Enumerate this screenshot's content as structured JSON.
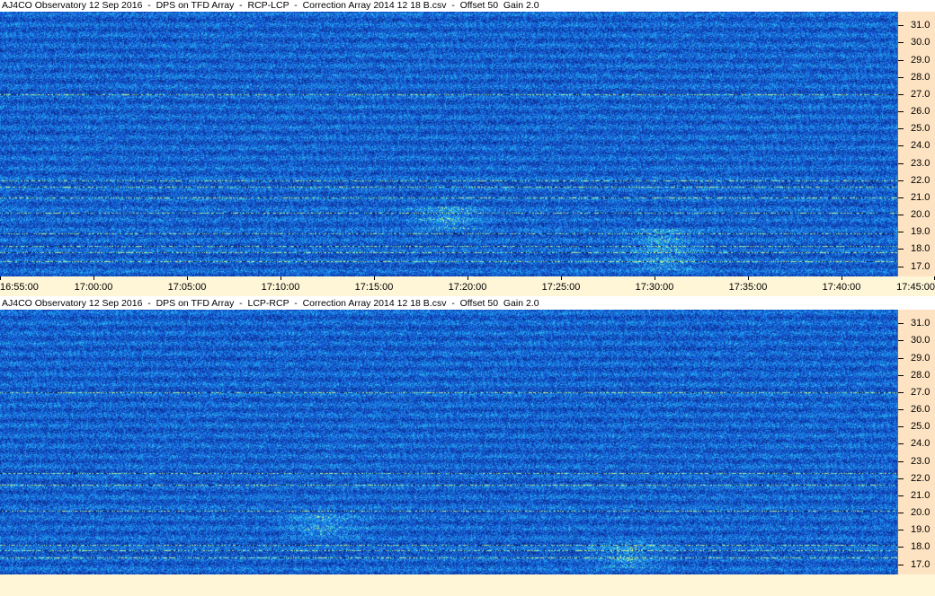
{
  "colors": {
    "background_blue": "#1a5fd6",
    "axis_panel": "#fde3c2",
    "time_strip": "#fff6d8"
  },
  "chart_data": [
    {
      "type": "heatmap",
      "title": "AJ4CO Observatory 12 Sep 2016  -  DPS on TFD Array  -  RCP-LCP  -  Correction Array 2014 12 18 B.csv  -  Offset 50  Gain 2.0",
      "ylabel_ticks": [
        "31.0",
        "30.0",
        "29.0",
        "28.0",
        "27.0",
        "26.0",
        "25.0",
        "24.0",
        "23.0",
        "22.0",
        "21.0",
        "20.0",
        "19.0",
        "18.0",
        "17.0"
      ],
      "ylim": [
        16.4,
        31.8
      ],
      "x_ticks": [
        "16:55:00",
        "17:00:00",
        "17:05:00",
        "17:10:00",
        "17:15:00",
        "17:20:00",
        "17:25:00",
        "17:30:00",
        "17:35:00",
        "17:40:00",
        "17:45:00"
      ],
      "interference_bands_MHz": [
        27.0,
        22.0,
        21.6,
        21.0,
        20.1,
        18.9,
        18.2,
        17.8,
        17.3
      ],
      "bursts": [
        {
          "time_min": 37,
          "freq_low": 16.8,
          "freq_high": 19.2
        },
        {
          "time_min": 25,
          "freq_low": 19.2,
          "freq_high": 20.5
        }
      ]
    },
    {
      "type": "heatmap",
      "title": "AJ4CO Observatory 12 Sep 2016  -  DPS on TFD Array  -  LCP-RCP  -  Correction Array 2014 12 18 B.csv  -  Offset 50  Gain 2.0",
      "ylabel_ticks": [
        "31.0",
        "30.0",
        "29.0",
        "28.0",
        "27.0",
        "26.0",
        "25.0",
        "24.0",
        "23.0",
        "22.0",
        "21.0",
        "20.0",
        "19.0",
        "18.0",
        "17.0"
      ],
      "ylim": [
        16.4,
        31.8
      ],
      "x_ticks": [],
      "interference_bands_MHz": [
        27.0,
        22.3,
        21.6,
        20.1,
        18.1,
        17.8,
        17.4
      ],
      "bursts": [
        {
          "time_min": 35,
          "freq_low": 16.8,
          "freq_high": 18.4
        },
        {
          "time_min": 18,
          "freq_low": 18.6,
          "freq_high": 20.0
        }
      ]
    }
  ]
}
